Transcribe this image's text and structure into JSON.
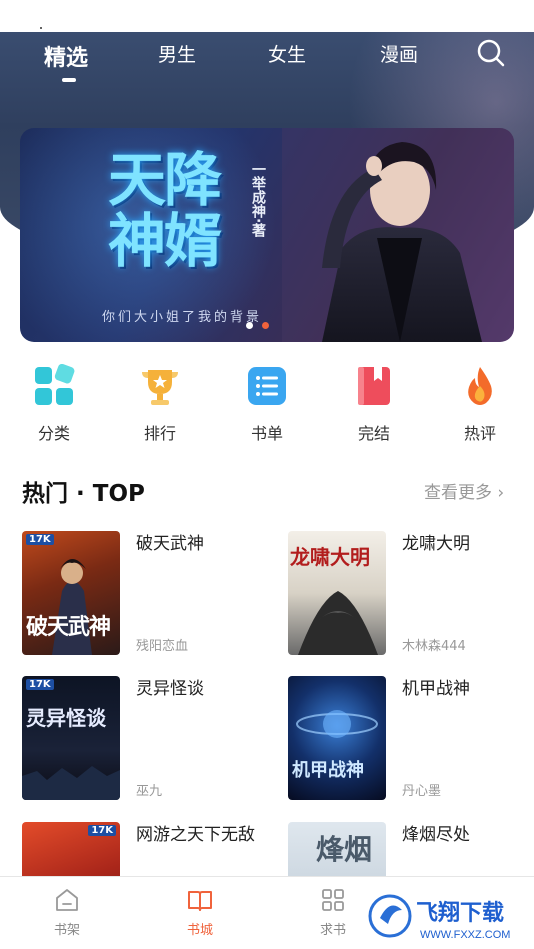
{
  "top_tabs": [
    {
      "label": "精选",
      "active": true
    },
    {
      "label": "男生",
      "active": false
    },
    {
      "label": "女生",
      "active": false
    },
    {
      "label": "漫画",
      "active": false
    }
  ],
  "banner": {
    "title": "天降神婿",
    "author_line": "一举成神·著",
    "tagline": "你们大小姐了我的背景",
    "slide_count": 2,
    "active_slide": 2,
    "colors": {
      "dot_inactive": "#ffffff",
      "dot_active": "#f0633c"
    }
  },
  "categories": [
    {
      "label": "分类",
      "icon": "grid-icon",
      "color": "#32c6d8"
    },
    {
      "label": "排行",
      "icon": "trophy-icon",
      "color": "#f5b13a"
    },
    {
      "label": "书单",
      "icon": "list-icon",
      "color": "#3aa6f0"
    },
    {
      "label": "完结",
      "icon": "bookmark-book-icon",
      "color": "#ee4d5c"
    },
    {
      "label": "热评",
      "icon": "flame-icon",
      "color": "#f36b2a"
    }
  ],
  "hot_section": {
    "title": "热门 · TOP",
    "more_label": "查看更多 ›"
  },
  "books": [
    {
      "title": "破天武神",
      "author": "残阳恋血",
      "cover_text": "破天武神",
      "cover_badge": "17K"
    },
    {
      "title": "龙啸大明",
      "author": "木林森444",
      "cover_text": "龙啸大明",
      "cover_badge": ""
    },
    {
      "title": "灵异怪谈",
      "author": "巫九",
      "cover_text": "灵异怪谈",
      "cover_badge": "17K"
    },
    {
      "title": "机甲战神",
      "author": "丹心墨",
      "cover_text": "机甲战神",
      "cover_badge": ""
    },
    {
      "title": "网游之天下无敌",
      "author": "",
      "cover_text": "",
      "cover_badge": "17K"
    },
    {
      "title": "烽烟尽处",
      "author": "",
      "cover_text": "烽烟",
      "cover_badge": ""
    }
  ],
  "bottom_nav": [
    {
      "label": "书架",
      "icon": "house-icon",
      "active": false
    },
    {
      "label": "书城",
      "icon": "open-book-icon",
      "active": true
    },
    {
      "label": "求书",
      "icon": "grid-squares-icon",
      "active": false
    }
  ],
  "watermark": {
    "main": "飞翔下载",
    "sub": "WWW.FXXZ.COM"
  },
  "colors": {
    "accent": "#f0633c",
    "hero_bg": "#34466a"
  }
}
